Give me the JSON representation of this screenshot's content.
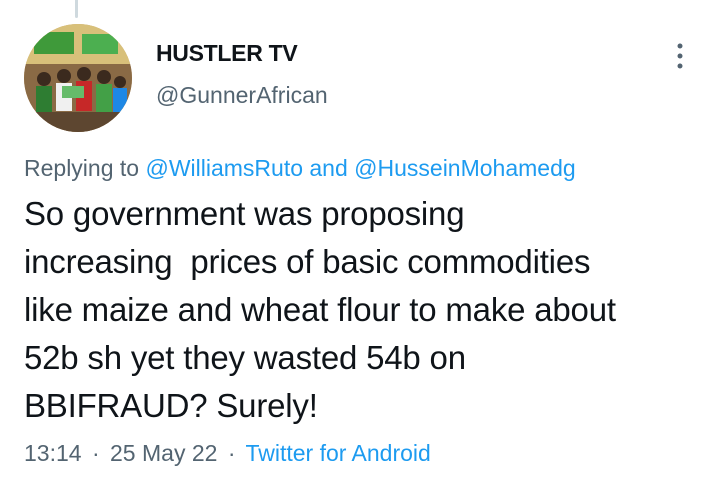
{
  "tweet": {
    "author": {
      "display_name": "HUSTLER TV",
      "handle": "@GunnerAfrican",
      "avatar_icon": "group-photo-avatar"
    },
    "more_icon": "more-options-icon",
    "reply_context": {
      "prefix": "Replying to",
      "mention_1": "@WilliamsRuto",
      "conjunction": "and",
      "mention_2": "@HusseinMohamedg"
    },
    "text": "So government was proposing\nincreasing  prices of basic commodities\nlike maize and wheat flour to make about\n52b sh yet they wasted 54b on\nBBIFRAUD? Surely!",
    "time": "13:14",
    "separator": "·",
    "date": "25 May 22",
    "source": "Twitter for Android"
  },
  "colors": {
    "link": "#1d9bf0",
    "secondary_text": "#536471",
    "primary_text": "#0f1419",
    "background": "#ffffff"
  }
}
